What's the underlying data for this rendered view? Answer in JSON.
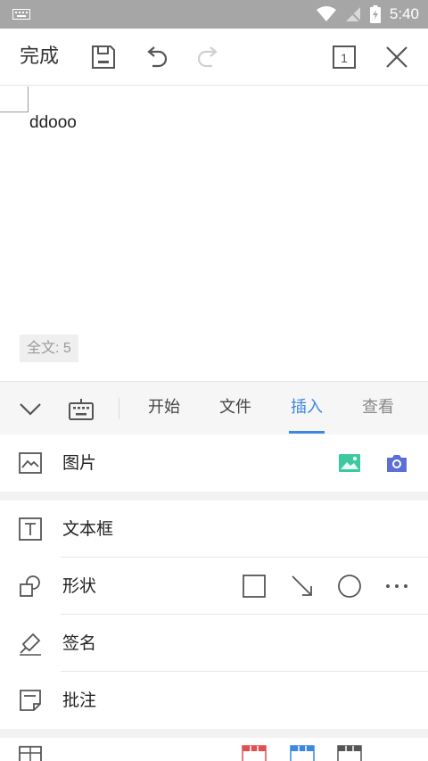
{
  "status_bar": {
    "time": "5:40"
  },
  "toolbar": {
    "done_label": "完成"
  },
  "document": {
    "text": "ddooo",
    "word_count": "全文: 5"
  },
  "ribbon": {
    "tabs": [
      {
        "label": "开始"
      },
      {
        "label": "文件"
      },
      {
        "label": "插入"
      },
      {
        "label": "查看"
      }
    ],
    "active_tab": "插入"
  },
  "insert_panel": {
    "items": [
      {
        "label": "图片",
        "icon": "image-icon"
      },
      {
        "label": "文本框",
        "icon": "textbox-icon"
      },
      {
        "label": "形状",
        "icon": "shape-icon"
      },
      {
        "label": "签名",
        "icon": "signature-icon"
      },
      {
        "label": "批注",
        "icon": "comment-icon"
      }
    ]
  },
  "colors": {
    "accent": "#3c87e0",
    "gallery": "#3cc9a0",
    "camera": "#5b6fd6",
    "table_red": "#e05050"
  }
}
